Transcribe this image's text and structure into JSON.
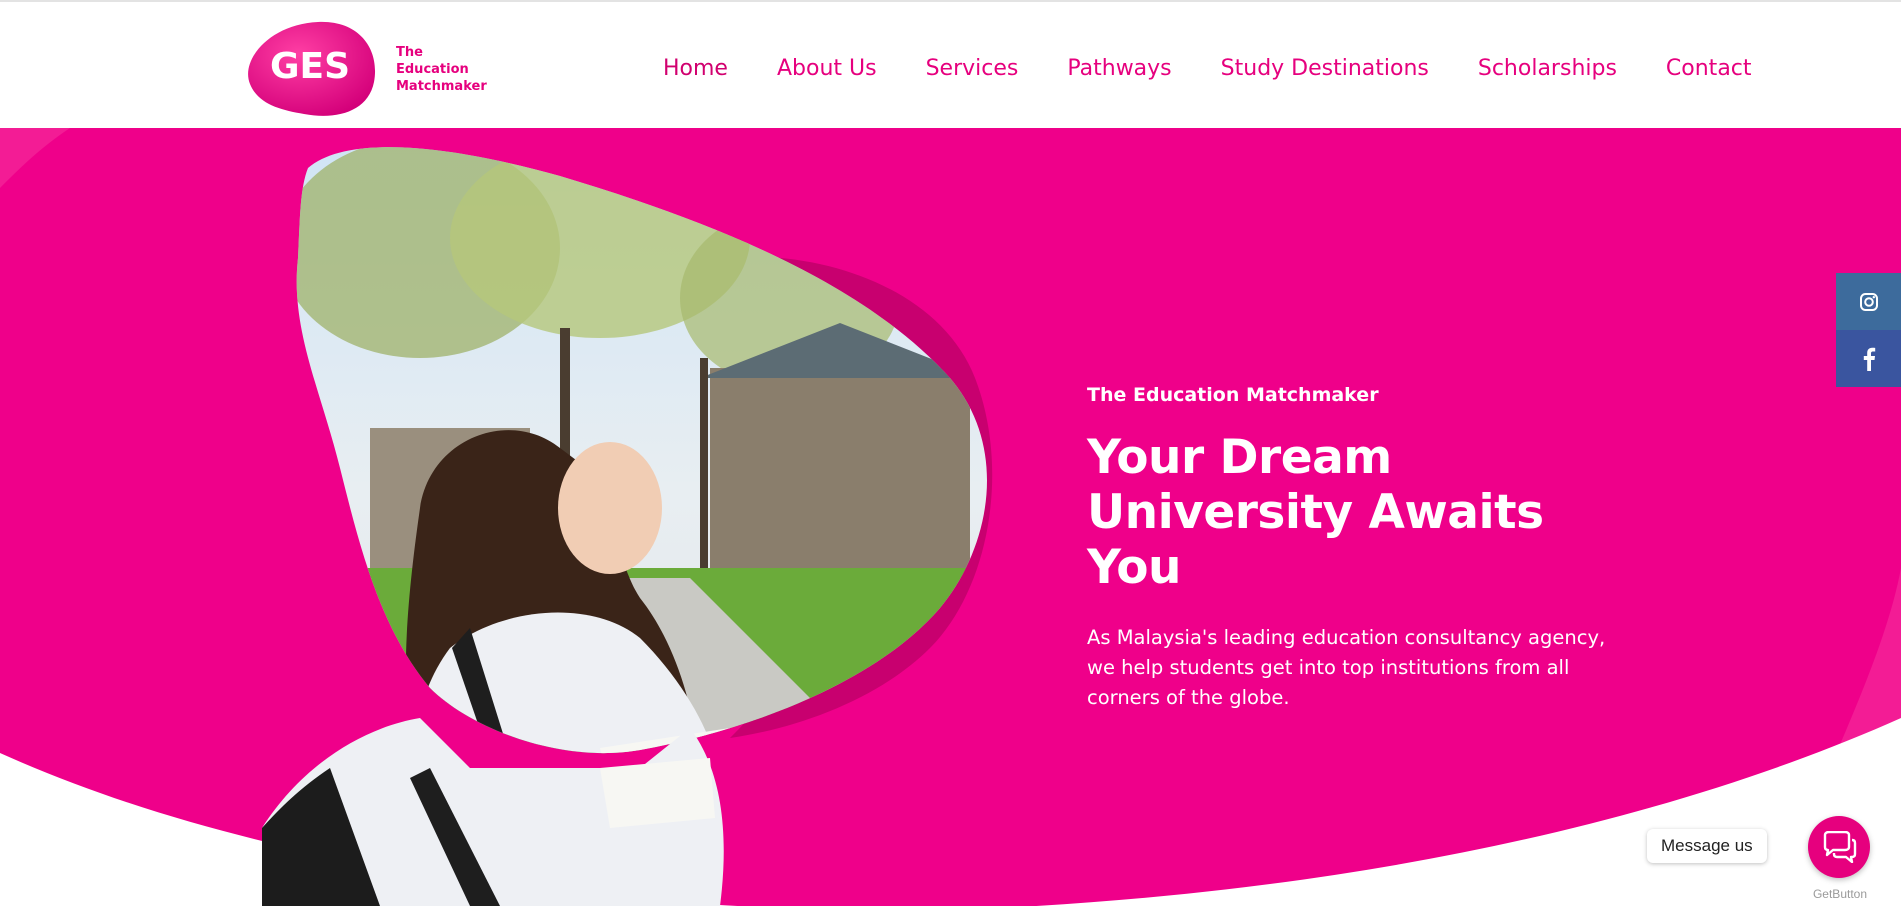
{
  "brand": {
    "logo_letters": "GES",
    "tagline_lines": [
      "The",
      "Education",
      "Matchmaker"
    ],
    "primary_color": "#e6007e"
  },
  "nav": {
    "items": [
      {
        "label": "Home"
      },
      {
        "label": "About Us"
      },
      {
        "label": "Services"
      },
      {
        "label": "Pathways"
      },
      {
        "label": "Study Destinations"
      },
      {
        "label": "Scholarships"
      },
      {
        "label": "Contact"
      }
    ]
  },
  "hero": {
    "eyebrow": "The Education Matchmaker",
    "title": "Your Dream University Awaits You",
    "description": "As Malaysia's leading education consultancy agency, we help students get into top institutions from all corners of the globe.",
    "background_color": "#ef008a"
  },
  "social": {
    "items": [
      {
        "icon": "instagram-icon",
        "color": "#3d6b9c"
      },
      {
        "icon": "facebook-icon",
        "color": "#3a559f"
      }
    ]
  },
  "widget": {
    "message_label": "Message us",
    "branding": "GetButton",
    "icon": "chat-bubbles-icon"
  }
}
